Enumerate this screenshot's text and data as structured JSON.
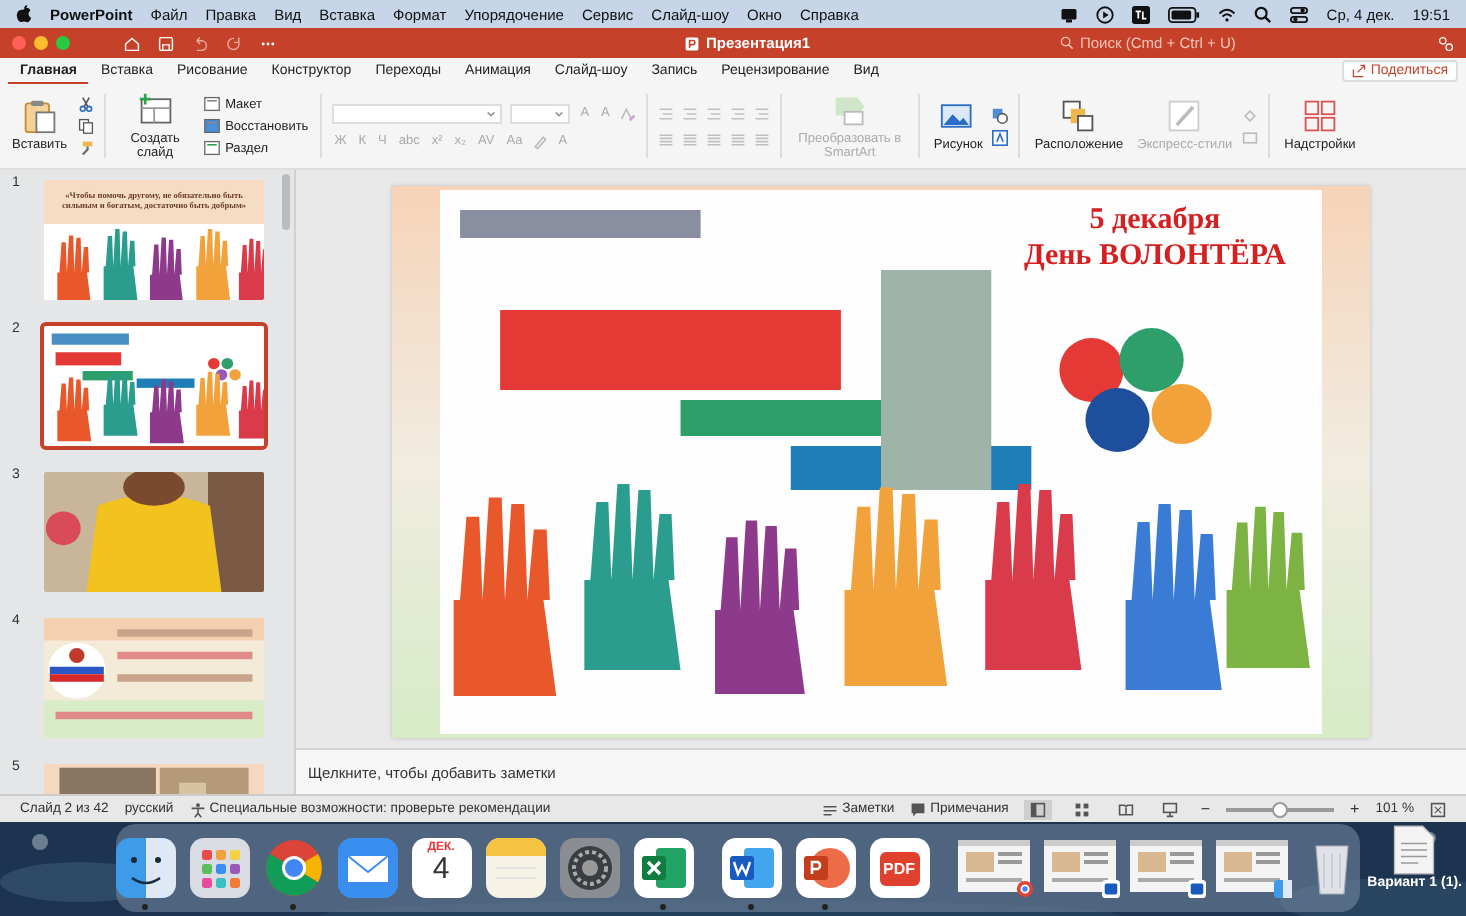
{
  "menu_bar": {
    "app": "PowerPoint",
    "items": [
      "Файл",
      "Правка",
      "Вид",
      "Вставка",
      "Формат",
      "Упорядочение",
      "Сервис",
      "Слайд-шоу",
      "Окно",
      "Справка"
    ],
    "date": "Ср, 4 дек.",
    "time": "19:51"
  },
  "window": {
    "title": "Презентация1",
    "search": {
      "placeholder": "Поиск (Cmd + Ctrl + U)"
    }
  },
  "tabs": [
    {
      "label": "Главная",
      "selected": true
    },
    {
      "label": "Вставка",
      "selected": false
    },
    {
      "label": "Рисование",
      "selected": false
    },
    {
      "label": "Конструктор",
      "selected": false
    },
    {
      "label": "Переходы",
      "selected": false
    },
    {
      "label": "Анимация",
      "selected": false
    },
    {
      "label": "Слайд-шоу",
      "selected": false
    },
    {
      "label": "Запись",
      "selected": false
    },
    {
      "label": "Рецензирование",
      "selected": false
    },
    {
      "label": "Вид",
      "selected": false
    }
  ],
  "share_button": "Поделиться",
  "ribbon": {
    "paste": {
      "label": "Вставить"
    },
    "new_slide": {
      "label": "Создать слайд"
    },
    "slide_buttons": [
      {
        "kind": "layout",
        "label": "Макет"
      },
      {
        "kind": "reset",
        "label": "Восстановить"
      },
      {
        "kind": "section",
        "label": "Раздел"
      }
    ],
    "font_size_glyphs": [
      "A",
      "A"
    ],
    "format_glyphs": [
      "Ж",
      "К",
      "Ч",
      "abc",
      "x²",
      "x₂",
      "AV",
      "Aa"
    ],
    "font_color_glyph": "A",
    "smartart": {
      "label": "Преобразовать в SmartArt",
      "disabled": true
    },
    "picture": {
      "label": "Рисунок",
      "disabled": false
    },
    "arrange": {
      "label": "Расположение",
      "disabled": false
    },
    "quick_styles": {
      "label": "Экспресс-стили",
      "disabled": true
    },
    "addins": {
      "label": "Надстройки",
      "disabled": false
    }
  },
  "slides": [
    {
      "number": "1",
      "selected": false,
      "kind": "quote",
      "quote": "«Чтобы помочь другому, не обязательно быть сильным и богатым, достаточно быть добрым»"
    },
    {
      "number": "2",
      "selected": true,
      "kind": "collage"
    },
    {
      "number": "3",
      "selected": false
    },
    {
      "number": "4",
      "selected": false,
      "kind": "badge"
    },
    {
      "number": "5",
      "selected": false,
      "kind": "gallery"
    }
  ],
  "slide": {
    "title_line_1": "5 декабря",
    "title_line_2": "День ВОЛОНТЁРА"
  },
  "notes": {
    "placeholder": "Щелкните, чтобы добавить заметки"
  },
  "status_bar": {
    "slide": "Слайд 2 из 42",
    "language": "русский",
    "accessibility": "Специальные возможности: проверьте рекомендации",
    "notes": "Заметки",
    "comments": "Примечания",
    "views": [
      {
        "selected": true
      },
      {
        "selected": false
      },
      {
        "selected": false
      },
      {
        "selected": false
      }
    ],
    "zoom_out": "−",
    "zoom": {
      "level": 0.5
    },
    "zoom_in": "+",
    "zoom_text": "101 %"
  },
  "dock": {
    "apps": [
      {
        "kind": "finder",
        "running": true
      },
      {
        "kind": "launchpad",
        "running": false
      },
      {
        "kind": "chrome",
        "running": true
      },
      {
        "kind": "mail",
        "running": false
      },
      {
        "kind": "calendar",
        "running": false,
        "month": "ДЕК.",
        "day": "4"
      },
      {
        "kind": "notes",
        "running": false
      },
      {
        "kind": "settings",
        "running": false
      },
      {
        "kind": "excel",
        "running": true
      }
    ],
    "documents": [
      {
        "kind": "word",
        "running": true
      },
      {
        "kind": "powerpoint",
        "running": true
      },
      {
        "kind": "pdf",
        "running": false,
        "label": "PDF"
      }
    ],
    "windows": [
      {
        "kind": "chrome"
      },
      {
        "kind": "word"
      },
      {
        "kind": "word"
      },
      {
        "kind": "finder"
      }
    ]
  },
  "desktop": {
    "file_label": "Вариант 1 (1)."
  }
}
